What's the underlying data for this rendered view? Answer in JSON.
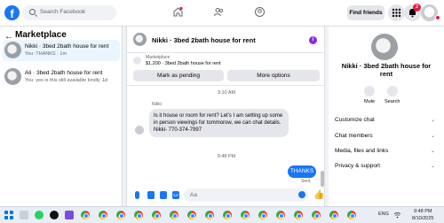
{
  "topbar": {
    "logo": "f",
    "search_placeholder": "Search Facebook",
    "find_friends": "Find friends",
    "notif_badge": "2"
  },
  "sidebar": {
    "title": "Marketplace",
    "conversations": [
      {
        "title": "Nikki · 3bed 2bath house for rent",
        "snippet": "You: THANKS · 1m"
      },
      {
        "title": "Ali · 3bed 2bath house for rent",
        "snippet": "You: yes is this still available kindly ...",
        "time": "1d"
      }
    ]
  },
  "chat": {
    "title": "Nikki · 3bed 2bath house for rent",
    "listing_label": "Marketplace",
    "listing_detail": "$1,200 · 3bed 2bath house for rent",
    "mark_pending": "Mark as pending",
    "more_options": "More options",
    "timestamp1": "3:10 AM",
    "sender": "Nikki",
    "incoming": "Is it house or room for rent? Let's I  am setting up some in person viewings for tommorow, we can chat details. Nikki- 770-374-7997",
    "timestamp2": "9:48 PM",
    "outgoing": "THANKS",
    "sent_label": "Sent",
    "composer_placeholder": "Aa"
  },
  "details": {
    "name": "Nikki · 3bed 2bath house for rent",
    "mute": "Mute",
    "search": "Search",
    "sections": [
      "Customize chat",
      "Chat members",
      "Media, files and links",
      "Privacy & support"
    ]
  },
  "taskbar": {
    "lang": "ENG",
    "time": "9:48 PM",
    "date": "8/10/2025"
  },
  "colors": {
    "accent": "#1877f2",
    "badge": "#e41e3f"
  }
}
